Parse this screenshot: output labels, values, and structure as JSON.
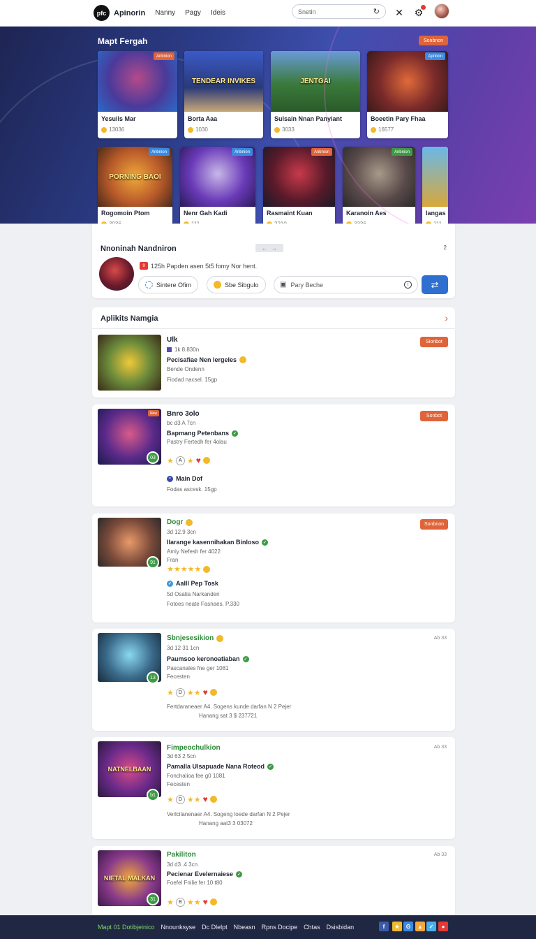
{
  "nav": {
    "logo_text": "pfc",
    "brand": "Apinorin",
    "links": [
      "Nanny",
      "Pagy",
      "Ideis"
    ],
    "search_placeholder": "Snetin"
  },
  "hero": {
    "title": "Mapt Fergah",
    "button": "Sonbnon",
    "row1": [
      {
        "name": "Yesuils Mar",
        "stat": "13036",
        "tag": "Anbnion",
        "art": ""
      },
      {
        "name": "Borta Aaa",
        "stat": "1030",
        "tag": "",
        "art": "TENDEAR INVIKES"
      },
      {
        "name": "Sulsain Nnan Panyiant",
        "stat": "3033",
        "tag": "",
        "art": "JENTGAI"
      },
      {
        "name": "Boeetin Pary Fhaa",
        "stat": "16577",
        "tag": "Apnbon",
        "art": ""
      }
    ],
    "row2": [
      {
        "name": "Rogomoin Ptom",
        "stat": "3036",
        "tag": "Anbnion",
        "art": "PORNING BAOI"
      },
      {
        "name": "Nenr Gah Kadi",
        "stat": "111",
        "tag": "Anbnion",
        "art": ""
      },
      {
        "name": "Rasmaint Kuan",
        "stat": "2210",
        "tag": "Anbnion",
        "art": ""
      },
      {
        "name": "Karanoin Aes",
        "stat": "3336",
        "tag": "Anbnion",
        "art": ""
      },
      {
        "name": "Iangas",
        "stat": "111",
        "tag": "",
        "art": ""
      }
    ]
  },
  "panel": {
    "title": "Nnoninah Nandniron",
    "count": "2",
    "note_flag": "9",
    "note": "125h Papden asen 5t5 fomy Nor hent.",
    "chip1": "Sintere Ofim",
    "chip2": "Sbe Sibgulo",
    "input_placeholder": "Pary Beche"
  },
  "section": {
    "title": "Aplikits Namgia"
  },
  "items": [
    {
      "title": "Ulk",
      "lines": [
        "1k 8.830n",
        "Pecisafiae Nen lergeles",
        "Bende Ondenn",
        "Fiodad nacsel. 15gp"
      ],
      "action": "Sionbot"
    },
    {
      "title": "Bnro 3olo",
      "lines": [
        "bc d3 A 7cn",
        "Bapmang Petenbans",
        "Pastry Fertedh fer 4olau",
        "Main Dof",
        "Fodas ascesk. 15gp"
      ],
      "rate_letter": "A",
      "level": "03",
      "action": "Sonbot"
    },
    {
      "title": "Dogr",
      "lines": [
        "3d 12.9 3cn",
        "Ilarange kasennihakan Binloso",
        "Amiy Nefesh fer 4022",
        "Fran",
        "Aalll Pep Tosk",
        "5d Osatia Narkanden",
        "Fotoes neate Fasnaes. P.330"
      ],
      "level": "91",
      "action": "Sonbnon"
    },
    {
      "title": "Sbnjesesikion",
      "lines": [
        "3d 12 31 1cn",
        "Paumsoo keronoatiaban",
        "Pascanales fne ger 1081",
        "Fecesten",
        "Fertdaraneaer A4. Sogens kunde darfan N 2 Pejer",
        "Hanang sat 3 $ 237721"
      ],
      "rate_letter": "D",
      "level": "13",
      "meta": "Ab 33"
    },
    {
      "title": "Fimpeochulkion",
      "lines": [
        "3d 63 2 5cn",
        "Pamalla Ulsapuade Nana Roteod",
        "Fonchalioa fee g0 1081",
        "Fecesten",
        "Verlcilanenaer A4. Sogeng loede darfan N 2 Pejer",
        "Hanang aat3 3 03072"
      ],
      "rate_letter": "D",
      "level": "b1",
      "meta": "Ab 33",
      "art": "NATNELBAAN"
    },
    {
      "title": "Pakiliton",
      "lines": [
        "3d d3 .4 3cn",
        "Pecienar Evelernaiese",
        "Foefel Fnilie fer 10 t80"
      ],
      "rate_letter": "B",
      "level": "31",
      "meta": "Ab 33",
      "art": "NIETAL MALKAN"
    }
  ],
  "footer": {
    "green": "Mapt 01 Dotibjeinico",
    "links": [
      "Nnounksyse",
      "Dc Dlelpt",
      "Nbeasn",
      "Rpns Docipe",
      "Chtas",
      "Dsisbidan"
    ]
  }
}
